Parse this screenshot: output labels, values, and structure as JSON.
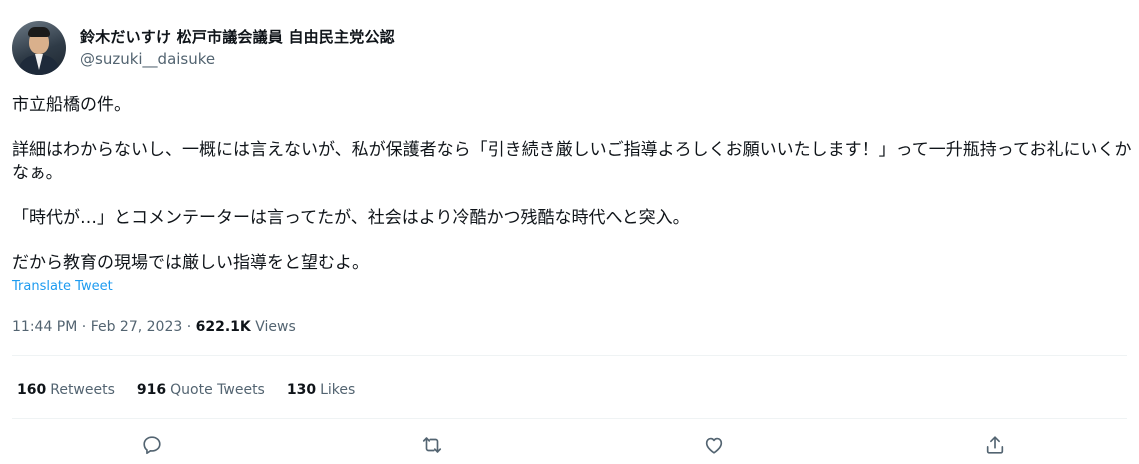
{
  "author": {
    "display_name": "鈴木だいすけ 松戸市議会議員 自由民主党公認",
    "handle": "@suzuki__daisuke"
  },
  "tweet": {
    "paragraphs": [
      "市立船橋の件。",
      "詳細はわからないし、一概には言えないが、私が保護者なら「引き続き厳しいご指導よろしくお願いいたします！」って一升瓶持ってお礼にいくかなぁ。",
      "「時代が…」とコメンテーターは言ってたが、社会はより冷酷かつ残酷な時代へと突入。",
      "だから教育の現場では厳しい指導をと望むよ。"
    ],
    "translate_label": "Translate Tweet"
  },
  "meta": {
    "time": "11:44 PM",
    "separator": "·",
    "date": "Feb 27, 2023",
    "views_count": "622.1K",
    "views_label": "Views"
  },
  "stats": {
    "retweets_count": "160",
    "retweets_label": "Retweets",
    "quote_count": "916",
    "quote_label": "Quote Tweets",
    "likes_count": "130",
    "likes_label": "Likes"
  },
  "icons": {
    "reply": "reply-icon",
    "retweet": "retweet-icon",
    "like": "like-icon",
    "share": "share-icon"
  }
}
